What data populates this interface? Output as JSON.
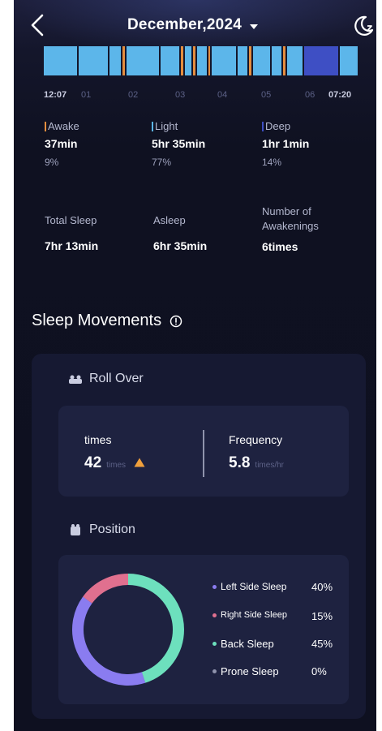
{
  "header": {
    "title": "December,2024"
  },
  "timeline": {
    "start_time": "12:07",
    "end_time": "07:20",
    "hours": [
      "01",
      "02",
      "03",
      "04",
      "05",
      "06"
    ]
  },
  "stages": [
    {
      "label": "Awake",
      "duration": "37min",
      "percent": "9%",
      "color": "#e58d3e"
    },
    {
      "label": "Light",
      "duration": "5hr 35min",
      "percent": "77%",
      "color": "#5cb6ea"
    },
    {
      "label": "Deep",
      "duration": "1hr 1min",
      "percent": "14%",
      "color": "#3e4fc4"
    }
  ],
  "summary": [
    {
      "label": "Total Sleep",
      "value": "7hr 13min"
    },
    {
      "label": "Asleep",
      "value": "6hr 35min"
    },
    {
      "label": "Number of\nAwakenings",
      "value": "6times"
    }
  ],
  "movements": {
    "title": "Sleep Movements",
    "roll_over": {
      "title": "Roll Over",
      "times_label": "times",
      "times_value": "42",
      "times_unit": "times",
      "frequency_label": "Frequency",
      "frequency_value": "5.8",
      "frequency_unit": "times/hr"
    },
    "position": {
      "title": "Position",
      "items": [
        {
          "name": "Left Side Sleep",
          "value": "40%",
          "fraction": 0.4,
          "color": "#8a7cf0"
        },
        {
          "name": "Right Side Sleep",
          "value": "15%",
          "fraction": 0.15,
          "color": "#e0708f"
        },
        {
          "name": "Back Sleep",
          "value": "45%",
          "fraction": 0.45,
          "color": "#6de0bd"
        },
        {
          "name": "Prone Sleep",
          "value": "0%",
          "fraction": 0.0,
          "color": "#8f93ac"
        }
      ]
    }
  },
  "colors": {
    "background": "#0f1121",
    "card": "#161932",
    "panel": "#1e2240",
    "warning": "#f0a03c"
  }
}
